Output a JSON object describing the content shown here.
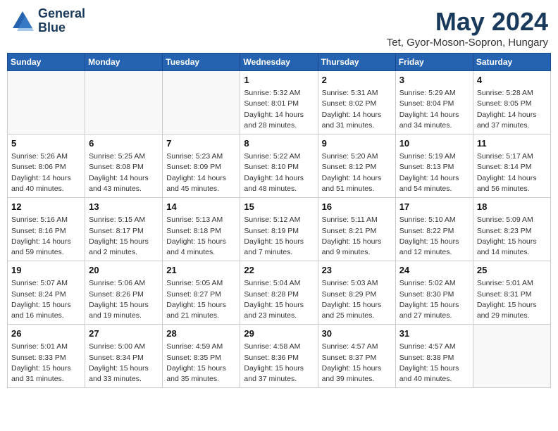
{
  "header": {
    "logo_line1": "General",
    "logo_line2": "Blue",
    "title": "May 2024",
    "subtitle": "Tet, Gyor-Moson-Sopron, Hungary"
  },
  "days_of_week": [
    "Sunday",
    "Monday",
    "Tuesday",
    "Wednesday",
    "Thursday",
    "Friday",
    "Saturday"
  ],
  "weeks": [
    [
      {
        "day": "",
        "info": ""
      },
      {
        "day": "",
        "info": ""
      },
      {
        "day": "",
        "info": ""
      },
      {
        "day": "1",
        "info": "Sunrise: 5:32 AM\nSunset: 8:01 PM\nDaylight: 14 hours\nand 28 minutes."
      },
      {
        "day": "2",
        "info": "Sunrise: 5:31 AM\nSunset: 8:02 PM\nDaylight: 14 hours\nand 31 minutes."
      },
      {
        "day": "3",
        "info": "Sunrise: 5:29 AM\nSunset: 8:04 PM\nDaylight: 14 hours\nand 34 minutes."
      },
      {
        "day": "4",
        "info": "Sunrise: 5:28 AM\nSunset: 8:05 PM\nDaylight: 14 hours\nand 37 minutes."
      }
    ],
    [
      {
        "day": "5",
        "info": "Sunrise: 5:26 AM\nSunset: 8:06 PM\nDaylight: 14 hours\nand 40 minutes."
      },
      {
        "day": "6",
        "info": "Sunrise: 5:25 AM\nSunset: 8:08 PM\nDaylight: 14 hours\nand 43 minutes."
      },
      {
        "day": "7",
        "info": "Sunrise: 5:23 AM\nSunset: 8:09 PM\nDaylight: 14 hours\nand 45 minutes."
      },
      {
        "day": "8",
        "info": "Sunrise: 5:22 AM\nSunset: 8:10 PM\nDaylight: 14 hours\nand 48 minutes."
      },
      {
        "day": "9",
        "info": "Sunrise: 5:20 AM\nSunset: 8:12 PM\nDaylight: 14 hours\nand 51 minutes."
      },
      {
        "day": "10",
        "info": "Sunrise: 5:19 AM\nSunset: 8:13 PM\nDaylight: 14 hours\nand 54 minutes."
      },
      {
        "day": "11",
        "info": "Sunrise: 5:17 AM\nSunset: 8:14 PM\nDaylight: 14 hours\nand 56 minutes."
      }
    ],
    [
      {
        "day": "12",
        "info": "Sunrise: 5:16 AM\nSunset: 8:16 PM\nDaylight: 14 hours\nand 59 minutes."
      },
      {
        "day": "13",
        "info": "Sunrise: 5:15 AM\nSunset: 8:17 PM\nDaylight: 15 hours\nand 2 minutes."
      },
      {
        "day": "14",
        "info": "Sunrise: 5:13 AM\nSunset: 8:18 PM\nDaylight: 15 hours\nand 4 minutes."
      },
      {
        "day": "15",
        "info": "Sunrise: 5:12 AM\nSunset: 8:19 PM\nDaylight: 15 hours\nand 7 minutes."
      },
      {
        "day": "16",
        "info": "Sunrise: 5:11 AM\nSunset: 8:21 PM\nDaylight: 15 hours\nand 9 minutes."
      },
      {
        "day": "17",
        "info": "Sunrise: 5:10 AM\nSunset: 8:22 PM\nDaylight: 15 hours\nand 12 minutes."
      },
      {
        "day": "18",
        "info": "Sunrise: 5:09 AM\nSunset: 8:23 PM\nDaylight: 15 hours\nand 14 minutes."
      }
    ],
    [
      {
        "day": "19",
        "info": "Sunrise: 5:07 AM\nSunset: 8:24 PM\nDaylight: 15 hours\nand 16 minutes."
      },
      {
        "day": "20",
        "info": "Sunrise: 5:06 AM\nSunset: 8:26 PM\nDaylight: 15 hours\nand 19 minutes."
      },
      {
        "day": "21",
        "info": "Sunrise: 5:05 AM\nSunset: 8:27 PM\nDaylight: 15 hours\nand 21 minutes."
      },
      {
        "day": "22",
        "info": "Sunrise: 5:04 AM\nSunset: 8:28 PM\nDaylight: 15 hours\nand 23 minutes."
      },
      {
        "day": "23",
        "info": "Sunrise: 5:03 AM\nSunset: 8:29 PM\nDaylight: 15 hours\nand 25 minutes."
      },
      {
        "day": "24",
        "info": "Sunrise: 5:02 AM\nSunset: 8:30 PM\nDaylight: 15 hours\nand 27 minutes."
      },
      {
        "day": "25",
        "info": "Sunrise: 5:01 AM\nSunset: 8:31 PM\nDaylight: 15 hours\nand 29 minutes."
      }
    ],
    [
      {
        "day": "26",
        "info": "Sunrise: 5:01 AM\nSunset: 8:33 PM\nDaylight: 15 hours\nand 31 minutes."
      },
      {
        "day": "27",
        "info": "Sunrise: 5:00 AM\nSunset: 8:34 PM\nDaylight: 15 hours\nand 33 minutes."
      },
      {
        "day": "28",
        "info": "Sunrise: 4:59 AM\nSunset: 8:35 PM\nDaylight: 15 hours\nand 35 minutes."
      },
      {
        "day": "29",
        "info": "Sunrise: 4:58 AM\nSunset: 8:36 PM\nDaylight: 15 hours\nand 37 minutes."
      },
      {
        "day": "30",
        "info": "Sunrise: 4:57 AM\nSunset: 8:37 PM\nDaylight: 15 hours\nand 39 minutes."
      },
      {
        "day": "31",
        "info": "Sunrise: 4:57 AM\nSunset: 8:38 PM\nDaylight: 15 hours\nand 40 minutes."
      },
      {
        "day": "",
        "info": ""
      }
    ]
  ]
}
